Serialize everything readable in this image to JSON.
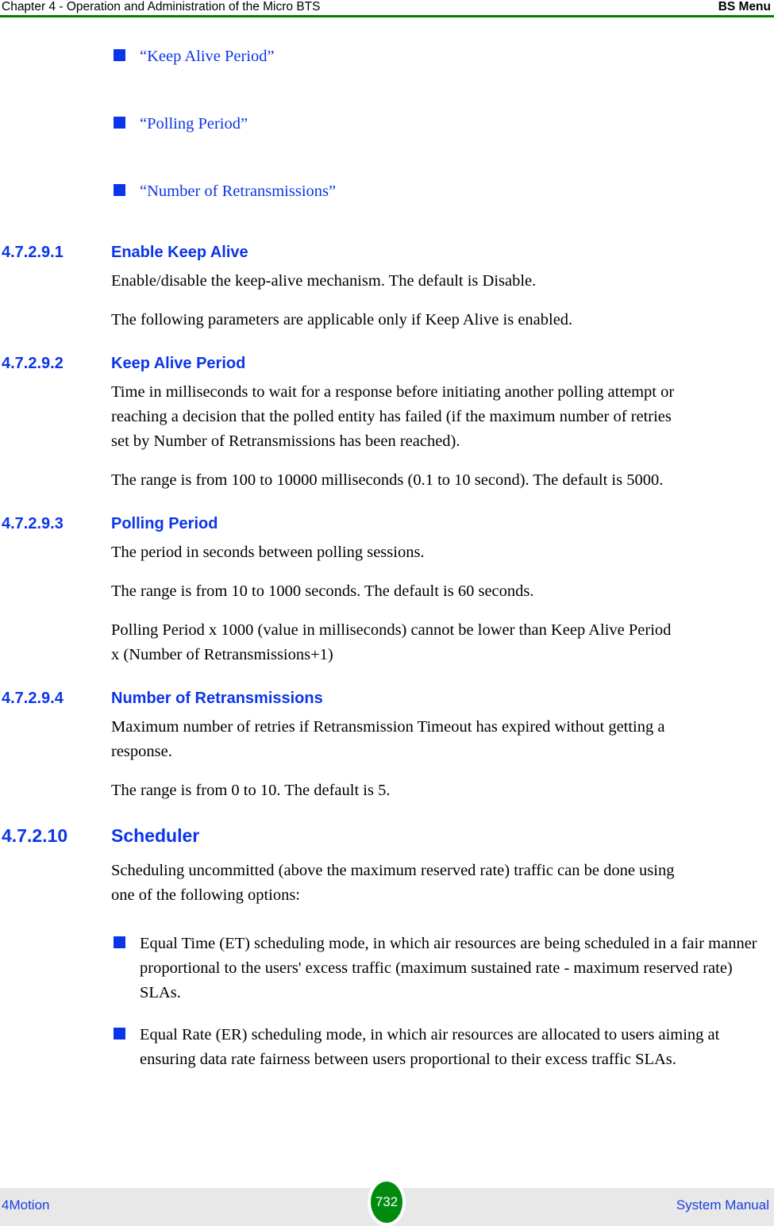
{
  "header": {
    "left": "Chapter 4 - Operation and Administration of the Micro BTS",
    "right": "BS Menu",
    "rule_color": "#008000"
  },
  "colors": {
    "link_blue": "#0B35E8",
    "heading_blue": "#0B35E8",
    "footer_blue": "#1A3FE0",
    "rule_green": "#008000",
    "badge_green": "#008A10",
    "footer_band": "#e8e8e8",
    "body_black": "#000000"
  },
  "link_list": [
    {
      "label": "“Keep Alive Period”"
    },
    {
      "label": "“Polling Period”"
    },
    {
      "label": "“Number of Retransmissions”"
    }
  ],
  "sections": [
    {
      "number": "4.7.2.9.1",
      "title": "Enable Keep Alive",
      "level": 4,
      "paragraphs": [
        "Enable/disable the keep-alive mechanism. The default is Disable.",
        "The following parameters are applicable only if Keep Alive is enabled."
      ]
    },
    {
      "number": "4.7.2.9.2",
      "title": "Keep Alive Period",
      "level": 4,
      "paragraphs": [
        "Time in milliseconds to wait for a response before initiating another polling attempt or reaching a decision that the polled entity has failed (if the maximum number of retries set by Number of Retransmissions has been reached).",
        "The range is from 100 to 10000 milliseconds (0.1 to 10 second). The default is 5000."
      ]
    },
    {
      "number": "4.7.2.9.3",
      "title": "Polling Period",
      "level": 4,
      "paragraphs": [
        "The period in seconds between polling sessions.",
        "The range is from 10 to 1000 seconds. The default is 60 seconds.",
        "Polling Period x 1000 (value in milliseconds) cannot be lower than Keep Alive Period x (Number of Retransmissions+1)"
      ]
    },
    {
      "number": "4.7.2.9.4",
      "title": "Number of Retransmissions",
      "level": 4,
      "paragraphs": [
        "Maximum number of retries if Retransmission Timeout has expired without getting a response.",
        "The range is from 0 to 10. The default is 5."
      ]
    },
    {
      "number": "4.7.2.10",
      "title": "Scheduler",
      "level": 3,
      "paragraphs": [
        "Scheduling uncommitted (above the maximum reserved rate) traffic can be done using one of the following options:"
      ],
      "bullets": [
        "Equal Time (ET) scheduling mode, in which air resources are being scheduled in a fair manner proportional to the users' excess traffic (maximum sustained rate - maximum reserved rate) SLAs.",
        "Equal Rate (ER) scheduling mode, in which air resources are allocated to users aiming at ensuring data rate fairness between users proportional to their excess traffic SLAs."
      ]
    }
  ],
  "footer": {
    "left": "4Motion",
    "page_number": "732",
    "right": "System Manual"
  }
}
